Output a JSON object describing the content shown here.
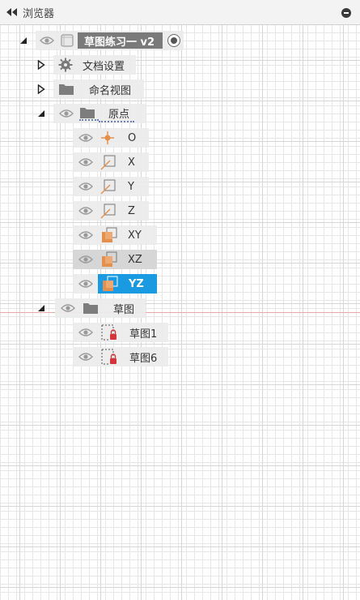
{
  "header": {
    "title": "浏览器"
  },
  "tree": {
    "root": {
      "label": "草图练习一 v2"
    },
    "doc_settings": {
      "label": "文档设置"
    },
    "named_views": {
      "label": "命名视图"
    },
    "origin": {
      "label": "原点",
      "items": [
        {
          "label": "O"
        },
        {
          "label": "X"
        },
        {
          "label": "Y"
        },
        {
          "label": "Z"
        },
        {
          "label": "XY"
        },
        {
          "label": "XZ"
        },
        {
          "label": "YZ"
        }
      ]
    },
    "sketches": {
      "label": "草图",
      "items": [
        {
          "label": "草图1"
        },
        {
          "label": "草图6"
        }
      ]
    }
  },
  "colors": {
    "accent_selected": "#1a9ae0",
    "plane_orange": "#e48f4b",
    "sketch_red": "#d4353a"
  }
}
